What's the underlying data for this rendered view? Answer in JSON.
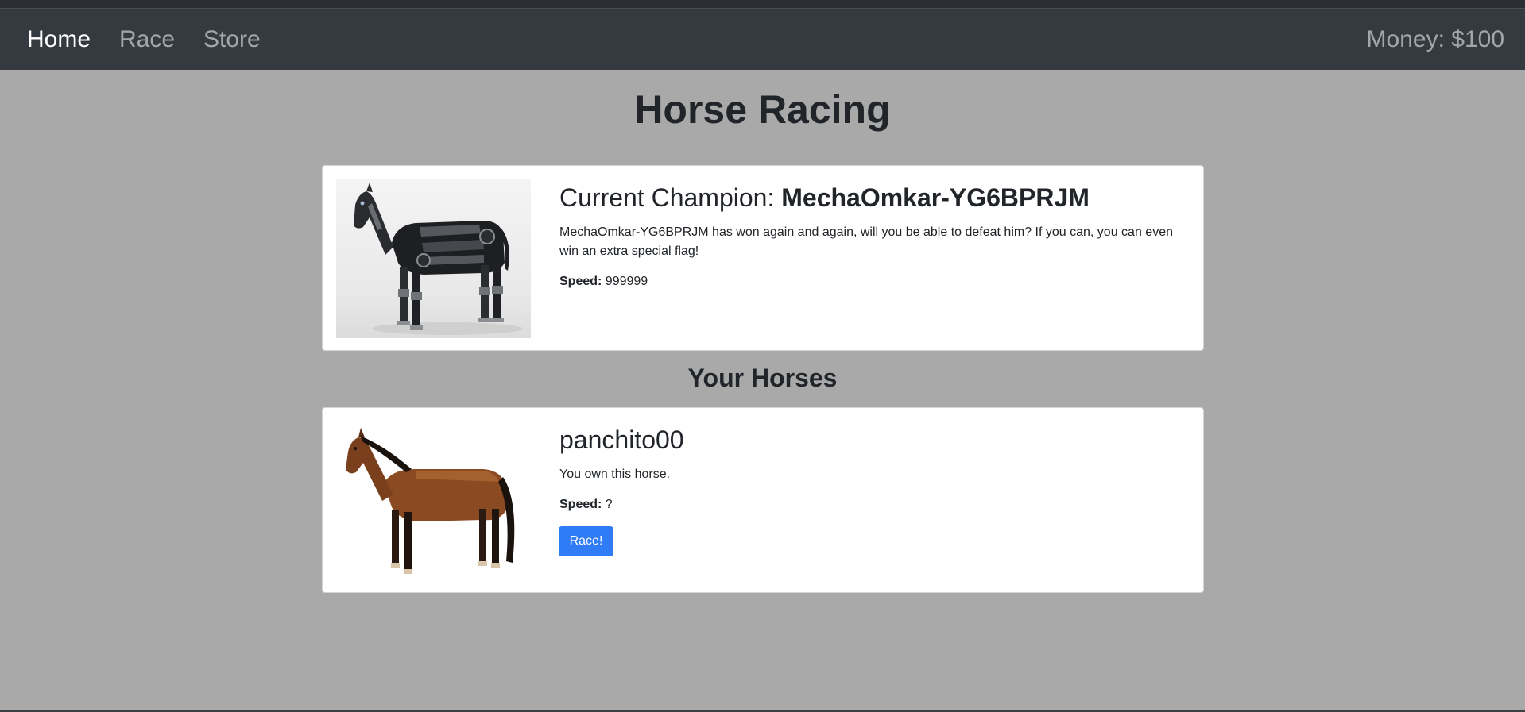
{
  "nav": {
    "items": [
      {
        "label": "Home",
        "active": true
      },
      {
        "label": "Race",
        "active": false
      },
      {
        "label": "Store",
        "active": false
      }
    ],
    "money": "Money: $100"
  },
  "page_title": "Horse Racing",
  "champion": {
    "title_prefix": "Current Champion: ",
    "name": "MechaOmkar-YG6BPRJM",
    "description": "MechaOmkar-YG6BPRJM has won again and again, will you be able to defeat him? If you can, you can even win an extra special flag!",
    "speed_label": "Speed:",
    "speed_value": "999999",
    "image_icon": "robot-horse-image"
  },
  "your_horses_title": "Your Horses",
  "horses": [
    {
      "name": "panchito00",
      "description": "You own this horse.",
      "speed_label": "Speed:",
      "speed_value": "?",
      "race_button": "Race!",
      "image_icon": "bay-horse-image"
    }
  ],
  "colors": {
    "navbar": "#343a40",
    "background": "#a9a9a9",
    "button": "#2f7cf6"
  }
}
